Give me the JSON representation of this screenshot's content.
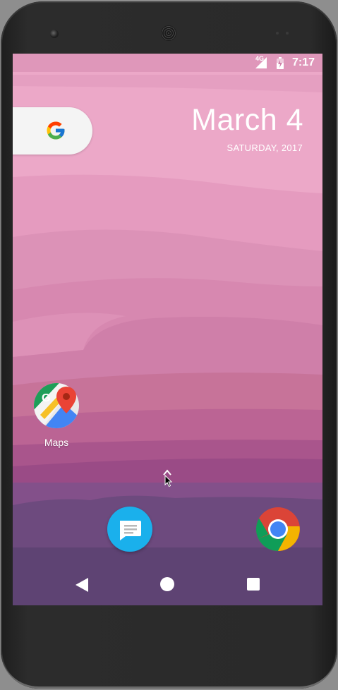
{
  "status_bar": {
    "network": "4G",
    "time": "7:17"
  },
  "search_widget": {
    "icon": "google-g-icon"
  },
  "clock_widget": {
    "date": "March 4",
    "day_year": "SATURDAY, 2017"
  },
  "home_apps": [
    {
      "label": "Maps",
      "icon": "google-maps-icon"
    }
  ],
  "dock": [
    {
      "icon": "messages-icon"
    },
    {
      "icon": "chrome-icon"
    }
  ],
  "nav_bar": {
    "back": "back-icon",
    "home": "home-icon",
    "recents": "recents-icon"
  },
  "colors": {
    "wallpaper_top": "#e9a3c4",
    "wallpaper_mid": "#c9779f",
    "wallpaper_bottom": "#5a3e72",
    "messages_blue": "#1ab0ec"
  }
}
